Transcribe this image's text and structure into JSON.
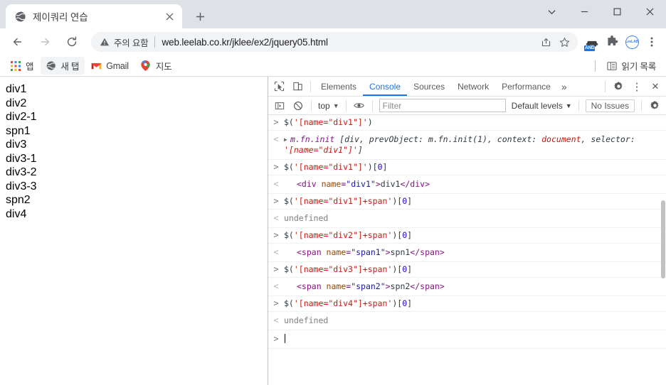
{
  "window": {
    "controls": [
      {
        "name": "tab-search-button",
        "glyph": "chevron-down"
      },
      {
        "name": "minimize-button",
        "glyph": "minimize"
      },
      {
        "name": "maximize-button",
        "glyph": "maximize"
      },
      {
        "name": "close-button",
        "glyph": "close"
      }
    ]
  },
  "tabstrip": {
    "tab_title": "제이쿼리 연습",
    "close_label": "×",
    "new_tab_label": "+"
  },
  "toolbar": {
    "back_label": "←",
    "forward_label": "→",
    "reload_label": "↻",
    "security_text": "주의 요함",
    "url": "web.leelab.co.kr/jklee/ex2/jquery05.html",
    "extensions": [
      {
        "name": "and-extension-icon",
        "badge": "AND"
      },
      {
        "name": "puzzle-extensions-icon",
        "badge": ""
      },
      {
        "name": "leelab-profile-icon",
        "badge": "LeeLAB"
      },
      {
        "name": "chrome-menu-icon",
        "badge": ""
      }
    ]
  },
  "bookmarks": {
    "items": [
      {
        "label": "앱",
        "icon": "apps-grid-icon",
        "active": false
      },
      {
        "label": "새 탭",
        "icon": "globe-icon",
        "active": true
      },
      {
        "label": "Gmail",
        "icon": "gmail-icon",
        "active": false
      },
      {
        "label": "지도",
        "icon": "maps-pin-icon",
        "active": false
      }
    ],
    "reading_list": "읽기 목록"
  },
  "page": {
    "lines": [
      "div1",
      "div2",
      "div2-1",
      "spn1",
      "div3",
      "div3-1",
      "div3-2",
      "div3-3",
      "spn2",
      "div4"
    ]
  },
  "devtools": {
    "tabs": [
      {
        "label": "Elements",
        "selected": false
      },
      {
        "label": "Console",
        "selected": true
      },
      {
        "label": "Sources",
        "selected": false
      },
      {
        "label": "Network",
        "selected": false
      },
      {
        "label": "Performance",
        "selected": false
      }
    ],
    "more_tabs_label": "»",
    "settings_label": "gear",
    "kebab_label": "⋮",
    "close_label": "✕",
    "filterbar": {
      "context": "top",
      "context_caret": "▼",
      "filter_placeholder": "Filter",
      "filter_value": "",
      "levels": "Default levels",
      "levels_caret": "▼",
      "issues": "No Issues"
    },
    "console_entries": [
      {
        "type": "input",
        "marker": ">",
        "segments": [
          {
            "t": "$(",
            "c": "punc"
          },
          {
            "t": "'[name=\"div1\"]'",
            "c": "str"
          },
          {
            "t": ")",
            "c": "punc"
          }
        ]
      },
      {
        "type": "output",
        "marker": "<",
        "expandable": true,
        "segments": [
          {
            "t": "m.fn.init ",
            "c": "fn"
          },
          {
            "t": "[div, prevObject: m.fn.init(1), context: ",
            "c": "ital"
          },
          {
            "t": "document",
            "c": "italr"
          },
          {
            "t": ", selector: ",
            "c": "ital"
          },
          {
            "t": "'[name=\"div1\"]'",
            "c": "italr"
          },
          {
            "t": "]",
            "c": "ital"
          }
        ]
      },
      {
        "type": "input",
        "marker": ">",
        "segments": [
          {
            "t": "$(",
            "c": "punc"
          },
          {
            "t": "'[name=\"div1\"]'",
            "c": "str"
          },
          {
            "t": ")[",
            "c": "punc"
          },
          {
            "t": "0",
            "c": "num"
          },
          {
            "t": "]",
            "c": "punc"
          }
        ]
      },
      {
        "type": "output",
        "marker": "<",
        "indent": true,
        "segments": [
          {
            "t": "<div",
            "c": "tag"
          },
          {
            "t": " name",
            "c": "attrn"
          },
          {
            "t": "=",
            "c": "tag"
          },
          {
            "t": "\"div1\"",
            "c": "attrv"
          },
          {
            "t": ">",
            "c": "tag"
          },
          {
            "t": "div1",
            "c": "text"
          },
          {
            "t": "</div>",
            "c": "tag"
          }
        ]
      },
      {
        "type": "input",
        "marker": ">",
        "segments": [
          {
            "t": "$(",
            "c": "punc"
          },
          {
            "t": "'[name=\"div1\"]+span'",
            "c": "str"
          },
          {
            "t": ")[",
            "c": "punc"
          },
          {
            "t": "0",
            "c": "num"
          },
          {
            "t": "]",
            "c": "punc"
          }
        ]
      },
      {
        "type": "output",
        "marker": "<",
        "segments": [
          {
            "t": "undefined",
            "c": "undef"
          }
        ]
      },
      {
        "type": "input",
        "marker": ">",
        "segments": [
          {
            "t": "$(",
            "c": "punc"
          },
          {
            "t": "'[name=\"div2\"]+span'",
            "c": "str"
          },
          {
            "t": ")[",
            "c": "punc"
          },
          {
            "t": "0",
            "c": "num"
          },
          {
            "t": "]",
            "c": "punc"
          }
        ]
      },
      {
        "type": "output",
        "marker": "<",
        "indent": true,
        "segments": [
          {
            "t": "<span",
            "c": "tag"
          },
          {
            "t": " name",
            "c": "attrn"
          },
          {
            "t": "=",
            "c": "tag"
          },
          {
            "t": "\"span1\"",
            "c": "attrv"
          },
          {
            "t": ">",
            "c": "tag"
          },
          {
            "t": "spn1",
            "c": "text"
          },
          {
            "t": "</span>",
            "c": "tag"
          }
        ]
      },
      {
        "type": "input",
        "marker": ">",
        "segments": [
          {
            "t": "$(",
            "c": "punc"
          },
          {
            "t": "'[name=\"div3\"]+span'",
            "c": "str"
          },
          {
            "t": ")[",
            "c": "punc"
          },
          {
            "t": "0",
            "c": "num"
          },
          {
            "t": "]",
            "c": "punc"
          }
        ]
      },
      {
        "type": "output",
        "marker": "<",
        "indent": true,
        "segments": [
          {
            "t": "<span",
            "c": "tag"
          },
          {
            "t": " name",
            "c": "attrn"
          },
          {
            "t": "=",
            "c": "tag"
          },
          {
            "t": "\"span2\"",
            "c": "attrv"
          },
          {
            "t": ">",
            "c": "tag"
          },
          {
            "t": "spn2",
            "c": "text"
          },
          {
            "t": "</span>",
            "c": "tag"
          }
        ]
      },
      {
        "type": "input",
        "marker": ">",
        "segments": [
          {
            "t": "$(",
            "c": "punc"
          },
          {
            "t": "'[name=\"div4\"]+span'",
            "c": "str"
          },
          {
            "t": ")[",
            "c": "punc"
          },
          {
            "t": "0",
            "c": "num"
          },
          {
            "t": "]",
            "c": "punc"
          }
        ]
      },
      {
        "type": "output",
        "marker": "<",
        "segments": [
          {
            "t": "undefined",
            "c": "undef"
          }
        ]
      },
      {
        "type": "prompt",
        "marker": ">",
        "segments": []
      }
    ]
  },
  "colors": {
    "accent": "#1a73e8",
    "chrome_bg": "#dee1e6",
    "string": "#c41a16",
    "number": "#1c00cf",
    "tag": "#881280",
    "attr_name": "#994500",
    "attr_value": "#1a1aa6",
    "fn_name": "#881391"
  }
}
